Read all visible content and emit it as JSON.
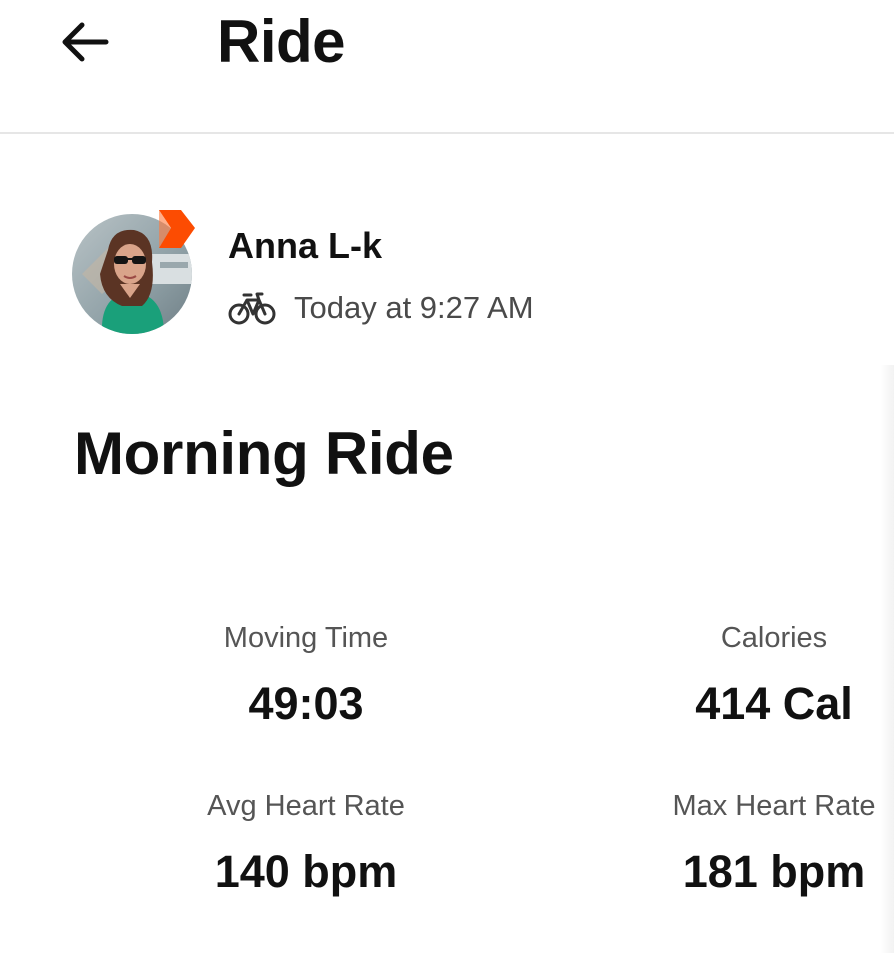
{
  "header": {
    "title": "Ride",
    "back_icon": "arrow-left-icon"
  },
  "athlete": {
    "name": "Anna L-k",
    "activity_icon": "bicycle-icon",
    "timestamp": "Today at 9:27 AM",
    "badge_color": "#fc4c02"
  },
  "activity": {
    "title": "Morning Ride"
  },
  "stats": [
    {
      "label": "Moving Time",
      "value": "49:03"
    },
    {
      "label": "Calories",
      "value": "414 Cal"
    },
    {
      "label": "Avg Heart Rate",
      "value": "140 bpm"
    },
    {
      "label": "Max Heart Rate",
      "value": "181 bpm"
    }
  ]
}
